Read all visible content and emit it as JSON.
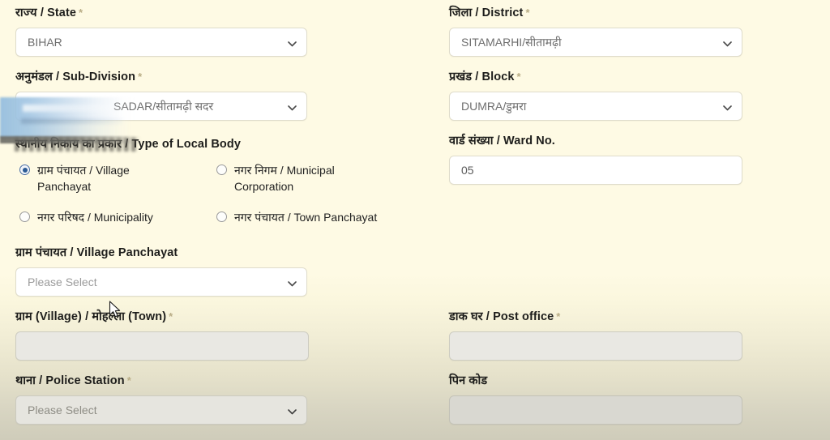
{
  "colors": {
    "page_top_bg": "#fefae4",
    "page_bottom_bg": "#cfccba",
    "field_bg": "#ffffff",
    "field_border": "#dfdccb",
    "label_text": "#1d1d1b",
    "value_text": "#6e6e6e",
    "required_asterisk": "#b9ad86",
    "radio_selected": "#2b5b95",
    "smear_blue": "#96bede"
  },
  "form": {
    "state": {
      "label_hi": "राज्य",
      "label_en": "State",
      "label": "राज्य / State",
      "required": "*",
      "value": "BIHAR",
      "control": "select"
    },
    "district": {
      "label_hi": "जिला",
      "label_en": "District",
      "label": "जिला / District",
      "required": "*",
      "value": "SITAMARHI/सीतामढ़ी",
      "control": "select"
    },
    "sub_division": {
      "label_hi": "अनुमंडल",
      "label_en": "Sub-Division",
      "label": "अनुमंडल / Sub-Division",
      "required": "*",
      "value": "SADAR/सीतामढ़ी सदर",
      "control": "select"
    },
    "block": {
      "label_hi": "प्रखंड",
      "label_en": "Block",
      "label": "प्रखंड / Block",
      "required": "*",
      "value": "DUMRA/डुमरा",
      "control": "select"
    },
    "local_body_type": {
      "label_hi": "स्थानीय निकाय का प्रकार",
      "label_en": "Type of Local Body",
      "label": "स्थानीय निकाय का प्रकार / Type of Local Body",
      "required": "",
      "control": "radio-group",
      "selected": "village_panchayat",
      "options": [
        {
          "id": "village_panchayat",
          "label": "ग्राम पंचायत / Village Panchayat",
          "selected": true
        },
        {
          "id": "municipal_corporation",
          "label": "नगर निगम / Municipal Corporation",
          "selected": false
        },
        {
          "id": "municipality",
          "label": "नगर परिषद / Municipality",
          "selected": false
        },
        {
          "id": "town_panchayat",
          "label": "नगर पंचायत / Town Panchayat",
          "selected": false
        }
      ]
    },
    "ward_no": {
      "label_hi": "वार्ड संख्या",
      "label_en": "Ward No.",
      "label": "वार्ड संख्या / Ward No.",
      "required": "",
      "value": "05",
      "control": "text"
    },
    "village_panchayat": {
      "label_hi": "ग्राम पंचायत",
      "label_en": "Village Panchayat",
      "label": "ग्राम पंचायत / Village Panchayat",
      "required": "",
      "value": "Please Select",
      "placeholder": "Please Select",
      "control": "select"
    },
    "village_town": {
      "label_hi": "ग्राम (Village) / मोहल्ला (Town)",
      "label_en": "",
      "label": "ग्राम (Village) / मोहल्ला (Town)",
      "required": "*",
      "value": "",
      "control": "text"
    },
    "post_office": {
      "label_hi": "डाक घर",
      "label_en": "Post office",
      "label": "डाक घर / Post office",
      "required": "*",
      "value": "",
      "control": "text"
    },
    "police_station": {
      "label_hi": "थाना",
      "label_en": "Police Station",
      "label": "थाना / Police Station",
      "required": "*",
      "value": "Please Select",
      "placeholder": "Please Select",
      "control": "select"
    },
    "pin_code": {
      "label_hi": "पिन कोड",
      "label_en": "",
      "label": "पिन कोड",
      "required": "",
      "value": "",
      "control": "text"
    }
  },
  "icons": {
    "chevron_down": "chevron-down-icon",
    "radio": "radio-button-icon",
    "cursor": "mouse-pointer-cursor"
  },
  "artifacts": {
    "blue_smear": "horizontal motion-blur streak over sub-division row",
    "grey_smear": "horizontal motion-blur streak over local body type label"
  }
}
